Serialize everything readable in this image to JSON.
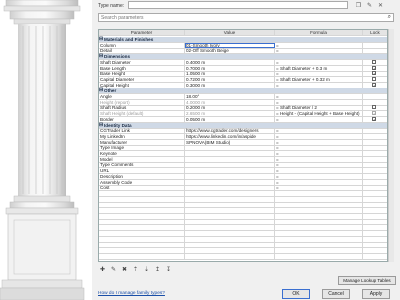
{
  "type_bar": {
    "label": "Type name:",
    "value": ""
  },
  "search": {
    "placeholder": "Search parameters"
  },
  "columns": [
    "Parameter",
    "Value",
    "Formula",
    "Lock"
  ],
  "groups": [
    {
      "name": "Materials and Finishes",
      "rows": [
        {
          "param": "Column",
          "value": "01-Smooth Ivory",
          "formula": "=",
          "lock": null,
          "grey": false,
          "selected": true
        },
        {
          "param": "Detail",
          "value": "02-Off Smooth Beige",
          "formula": "=",
          "lock": null,
          "grey": false,
          "selected": false
        }
      ]
    },
    {
      "name": "Dimensions",
      "rows": [
        {
          "param": "Shaft Diameter",
          "value": "0.4000 m",
          "formula": "=",
          "lock": false,
          "grey": false
        },
        {
          "param": "Base Length",
          "value": "0.7000 m",
          "formula": "= Shaft Diameter + 0.3 m",
          "lock": true,
          "grey": false
        },
        {
          "param": "Base Height",
          "value": "1.0500 m",
          "formula": "=",
          "lock": true,
          "grey": false
        },
        {
          "param": "Capital Diameter",
          "value": "0.7200 m",
          "formula": "= Shaft Diameter + 0.32 m",
          "lock": false,
          "grey": false
        },
        {
          "param": "Capital Height",
          "value": "0.3000 m",
          "formula": "=",
          "lock": true,
          "grey": false
        }
      ]
    },
    {
      "name": "Other",
      "rows": [
        {
          "param": "Angle",
          "value": "18.00°",
          "formula": "=",
          "lock": null,
          "grey": false
        },
        {
          "param": "Height (report)",
          "value": "4.0000 m",
          "formula": "=",
          "lock": null,
          "grey": true
        },
        {
          "param": "Shaft Radius",
          "value": "0.2000 m",
          "formula": "= Shaft Diameter / 2",
          "lock": false,
          "grey": false
        },
        {
          "param": "Shaft Height (default)",
          "value": "2.6500 m",
          "formula": "= Height - (Capital Height + Base Height)",
          "lock": true,
          "grey": true
        },
        {
          "param": "Border",
          "value": "0.0500 m",
          "formula": "=",
          "lock": true,
          "grey": false
        }
      ]
    },
    {
      "name": "Identity Data",
      "rows": [
        {
          "param": "CGTrader Link",
          "value": "https://www.cgtrader.com/designers",
          "formula": "=",
          "lock": null,
          "grey": false
        },
        {
          "param": "My LinkedIn",
          "value": "https://www.linkedin.com/in/aspide",
          "formula": "=",
          "lock": null,
          "grey": false
        },
        {
          "param": "Manufacturer",
          "value": "SPNOVA(BIM Studio)",
          "formula": "=",
          "lock": null,
          "grey": false
        },
        {
          "param": "Type Image",
          "value": "",
          "formula": "=",
          "lock": null,
          "grey": false
        },
        {
          "param": "Keynote",
          "value": "",
          "formula": "=",
          "lock": null,
          "grey": false
        },
        {
          "param": "Model",
          "value": "",
          "formula": "=",
          "lock": null,
          "grey": false
        },
        {
          "param": "Type Comments",
          "value": "",
          "formula": "=",
          "lock": null,
          "grey": false
        },
        {
          "param": "URL",
          "value": "",
          "formula": "=",
          "lock": null,
          "grey": false
        },
        {
          "param": "Description",
          "value": "",
          "formula": "=",
          "lock": null,
          "grey": false
        },
        {
          "param": "Assembly Code",
          "value": "",
          "formula": "=",
          "lock": null,
          "grey": false
        },
        {
          "param": "Cost",
          "value": "",
          "formula": "=",
          "lock": null,
          "grey": false
        }
      ]
    }
  ],
  "toolbar_icons": [
    "new-parameter-icon",
    "edit-parameter-icon",
    "delete-parameter-icon",
    "move-up-icon",
    "move-down-icon",
    "sort-ascending-icon",
    "sort-descending-icon"
  ],
  "manage_lookup_label": "Manage Lookup Tables",
  "help_link": "How do I manage family types?",
  "buttons": {
    "ok": "OK",
    "cancel": "Cancel",
    "apply": "Apply"
  }
}
